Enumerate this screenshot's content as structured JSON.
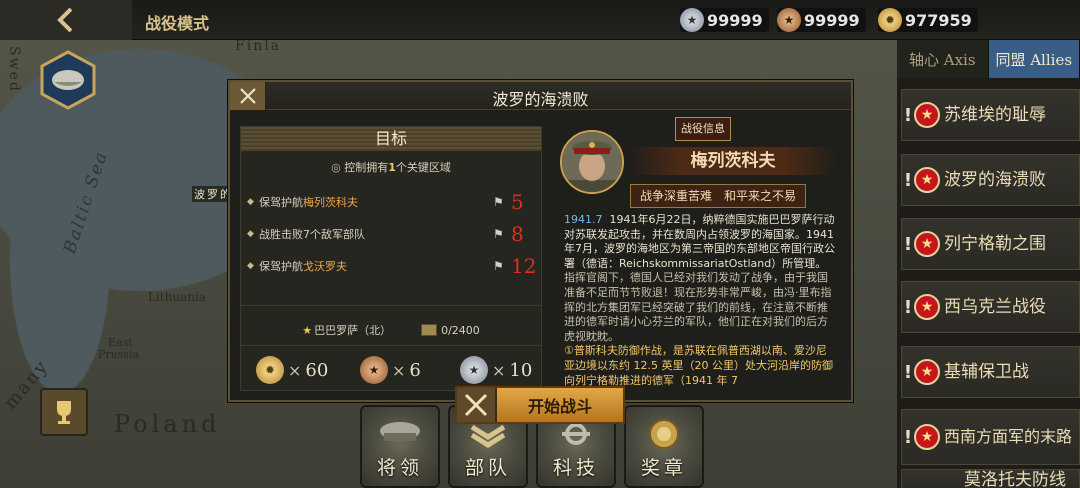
{
  "topbar": {
    "mode_title": "战役模式",
    "resources": [
      {
        "icon": "silver-medal-icon",
        "value": "99999"
      },
      {
        "icon": "bronze-medal-icon",
        "value": "99999"
      },
      {
        "icon": "gold-star-medal-icon",
        "value": "977959"
      }
    ]
  },
  "map": {
    "labels": {
      "finland": "Finla",
      "baltic_sea": "Baltic Sea",
      "swed": "Swed",
      "lithuania": "Lithuania",
      "east_prussia_1": "East",
      "east_prussia_2": "Prussia",
      "poland": "Poland",
      "many": "many",
      "baltic_marker": "波罗的"
    }
  },
  "factions": {
    "axis": "轴心 Axis",
    "allies": "同盟 Allies"
  },
  "campaigns": [
    {
      "name": "苏维埃的耻辱"
    },
    {
      "name": "波罗的海溃败"
    },
    {
      "name": "列宁格勒之围"
    },
    {
      "name": "西乌克兰战役"
    },
    {
      "name": "基辅保卫战"
    },
    {
      "name": "西南方面军的末路"
    },
    {
      "name": "莫洛托夫防线"
    }
  ],
  "bottom_menu": {
    "generals": "将领",
    "troops": "部队",
    "tech": "科技",
    "medals": "奖章"
  },
  "dialog": {
    "title": "波罗的海溃败",
    "objectives": {
      "header": "目标",
      "sub_prefix": "控制拥有",
      "sub_count": "1",
      "sub_suffix": "个关键区域",
      "items": [
        {
          "prefix": "保驾护航",
          "highlight": "梅列茨科夫",
          "suffix": "",
          "turns": "5"
        },
        {
          "prefix": "战胜击败",
          "highlight": "7",
          "suffix": "个敌军部队",
          "turns": "8"
        },
        {
          "prefix": "保驾护航",
          "highlight": "戈沃罗夫",
          "suffix": "",
          "turns": "12"
        }
      ]
    },
    "reward": {
      "operation": "巴巴罗萨（北）",
      "progress": "0/2400"
    },
    "loot": [
      {
        "icon": "gold-star-medal-icon",
        "count": "60"
      },
      {
        "icon": "bronze-medal-icon",
        "count": "6"
      },
      {
        "icon": "silver-medal-icon",
        "count": "10"
      }
    ],
    "info_tag": "战役信息",
    "general_name": "梅列茨科夫",
    "motto": "战争深重苦难　和平来之不易",
    "desc": {
      "date": "1941.7",
      "p1": "1941年6月22日，纳粹德国实施巴巴罗萨行动对苏联发起攻击，并在数周内占领波罗的海国家。1941年7月，波罗的海地区为第三帝国的东部地区帝国行政公署（德语：ReichskommissariatOstland）所管理。",
      "p2": "指挥官阁下，德国人已经对我们发动了战争，由于我国准备不足而节节败退！现在形势非常严峻，由冯·里布指挥的北方集团军已经突破了我们的前线，在注意不断推进的德军时请小心芬兰的军队，他们正在对我们的后方虎视眈眈。",
      "p3": "①普斯科夫防御作战，是苏联在佩普西湖以南、爱沙尼亚边境以东约 12.5 英里（20 公里）处大河沿岸的防御向列宁格勒推进的德军（1941 年 7"
    },
    "start_button": "开始战斗"
  }
}
